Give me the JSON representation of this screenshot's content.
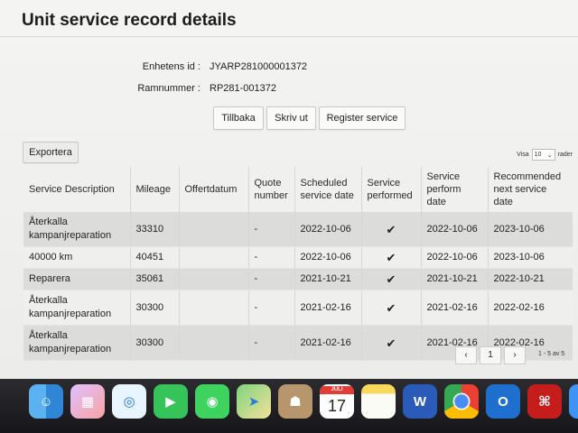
{
  "page": {
    "title": "Unit service record details",
    "unit_id_label": "Enhetens id :",
    "unit_id_value": "JYARP281000001372",
    "frame_label": "Ramnummer :",
    "frame_value": "RP281-001372"
  },
  "actions": {
    "back": "Tillbaka",
    "print": "Skriv ut",
    "register": "Register service",
    "export": "Exportera"
  },
  "table_controls": {
    "show_label": "Visa",
    "page_size": "10",
    "rows_label": "rader"
  },
  "table": {
    "headers": [
      "Service Description",
      "Mileage",
      "Offertdatum",
      "Quote number",
      "Scheduled service date",
      "Service performed",
      "Service perform date",
      "Recommended next service date"
    ],
    "rows": [
      [
        "Återkalla kampanjreparation",
        "33310",
        "",
        "-",
        "2022-10-06",
        "✔",
        "2022-10-06",
        "2023-10-06"
      ],
      [
        "40000 km",
        "40451",
        "",
        "-",
        "2022-10-06",
        "✔",
        "2022-10-06",
        "2023-10-06"
      ],
      [
        "Reparera",
        "35061",
        "",
        "-",
        "2021-10-21",
        "✔",
        "2021-10-21",
        "2022-10-21"
      ],
      [
        "Återkalla kampanjreparation",
        "30300",
        "",
        "-",
        "2021-02-16",
        "✔",
        "2021-02-16",
        "2022-02-16"
      ],
      [
        "Återkalla kampanjreparation",
        "30300",
        "",
        "-",
        "2021-02-16",
        "✔",
        "2021-02-16",
        "2022-02-16"
      ]
    ]
  },
  "pagination": {
    "prev": "‹",
    "current": "1",
    "next": "›",
    "info": "1 - 5 av 5"
  },
  "dock": {
    "apps": [
      "finder-icon",
      "launchpad-icon",
      "safari-icon",
      "facetime-icon",
      "messages-icon",
      "maps-icon",
      "contacts-icon",
      "calendar-icon",
      "notes-icon",
      "word-icon",
      "chrome-icon",
      "outlook-icon",
      "acrobat-icon",
      "mail-icon"
    ],
    "calendar_month": "JULI",
    "calendar_day": "17"
  }
}
